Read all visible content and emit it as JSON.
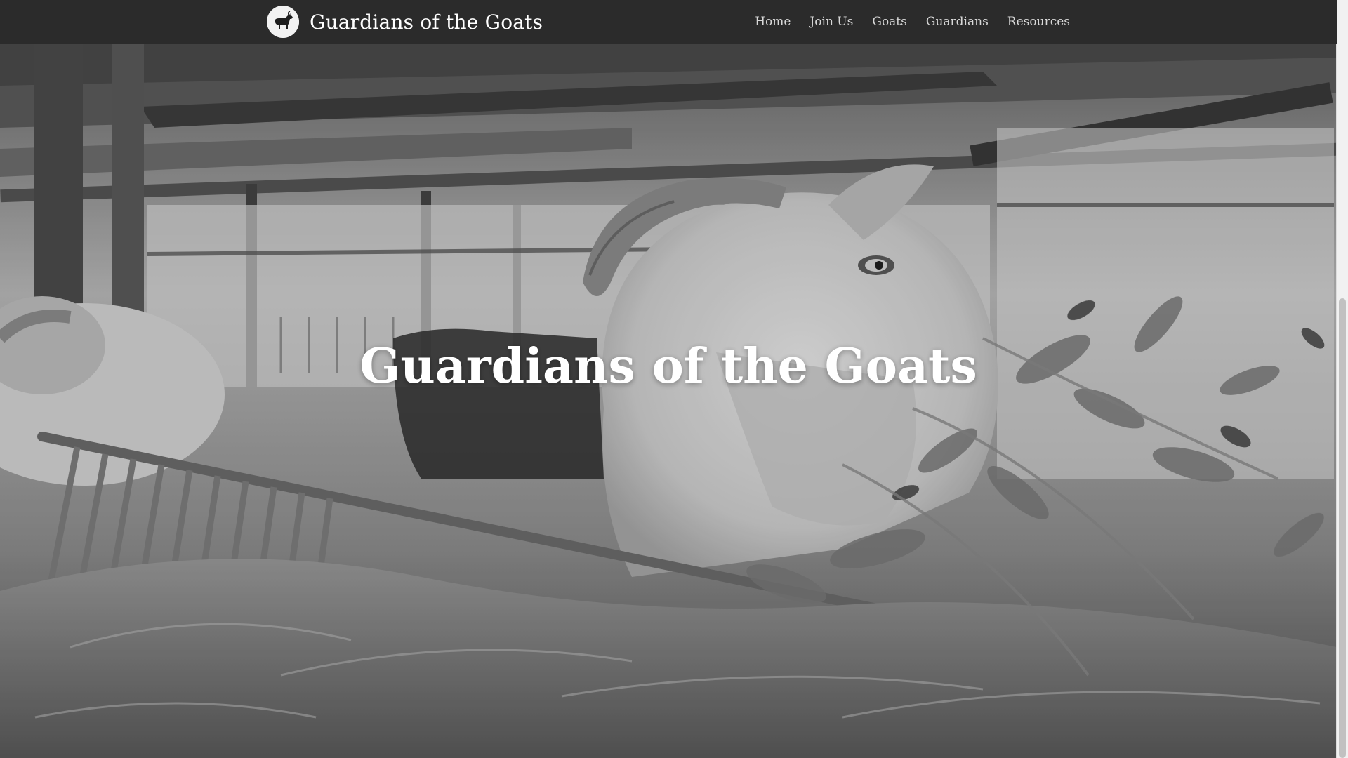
{
  "site": {
    "title": "Guardians of the Goats",
    "logo_icon": "goat-logo-icon"
  },
  "nav": {
    "items": [
      {
        "label": "Home"
      },
      {
        "label": "Join Us"
      },
      {
        "label": "Goats"
      },
      {
        "label": "Guardians"
      },
      {
        "label": "Resources"
      }
    ]
  },
  "hero": {
    "heading": "Guardians of the Goats",
    "image_tone": "black-and-white"
  },
  "colors": {
    "navbar_bg": "#2b2b2b",
    "brand_text": "#ffffff",
    "nav_text": "#d8d8d8",
    "hero_text": "#ffffff"
  }
}
